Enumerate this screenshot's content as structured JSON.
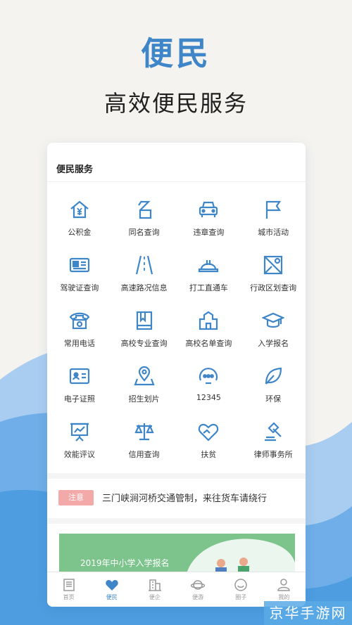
{
  "hero": {
    "title": "便民",
    "subtitle": "高效便民服务"
  },
  "services_section": {
    "title": "便民服务",
    "items": [
      {
        "label": "公积金",
        "icon": "house-yen-icon"
      },
      {
        "label": "同名查询",
        "icon": "name-char-icon"
      },
      {
        "label": "违章查询",
        "icon": "car-icon"
      },
      {
        "label": "城市活动",
        "icon": "flag-icon"
      },
      {
        "label": "驾驶证查询",
        "icon": "license-card-icon"
      },
      {
        "label": "高速路况信息",
        "icon": "road-icon"
      },
      {
        "label": "打工直通车",
        "icon": "helmet-icon"
      },
      {
        "label": "行政区划查询",
        "icon": "map-pin-icon"
      },
      {
        "label": "常用电话",
        "icon": "telephone-icon"
      },
      {
        "label": "高校专业查询",
        "icon": "book-icon"
      },
      {
        "label": "高校名单查询",
        "icon": "school-building-icon"
      },
      {
        "label": "入学报名",
        "icon": "graduation-cap-icon"
      },
      {
        "label": "电子证照",
        "icon": "id-card-icon"
      },
      {
        "label": "招生划片",
        "icon": "location-area-icon"
      },
      {
        "label": "12345",
        "icon": "hotline-face-icon"
      },
      {
        "label": "环保",
        "icon": "leaf-icon"
      },
      {
        "label": "效能评议",
        "icon": "presentation-chart-icon"
      },
      {
        "label": "信用查询",
        "icon": "scale-icon"
      },
      {
        "label": "扶贫",
        "icon": "heart-hands-icon"
      },
      {
        "label": "律师事务所",
        "icon": "gavel-icon"
      }
    ]
  },
  "notice": {
    "tag": "注意",
    "text": "三门峡涧河桥交通管制，来往货车请绕行"
  },
  "banner": {
    "text": "2019年中小学入学报名"
  },
  "tabs": [
    {
      "label": "首页",
      "icon": "newspaper-icon",
      "active": false
    },
    {
      "label": "便民",
      "icon": "heart-icon",
      "active": true
    },
    {
      "label": "便企",
      "icon": "building-icon",
      "active": false
    },
    {
      "label": "便游",
      "icon": "planet-icon",
      "active": false
    },
    {
      "label": "圈子",
      "icon": "smile-circle-icon",
      "active": false
    },
    {
      "label": "我的",
      "icon": "user-icon",
      "active": false
    }
  ],
  "watermark": "京华手游网",
  "colors": {
    "accent": "#3f86c9",
    "notice_tag": "#f4a9a9",
    "banner": "#7cc48c",
    "wave": "#5ba6e3"
  }
}
